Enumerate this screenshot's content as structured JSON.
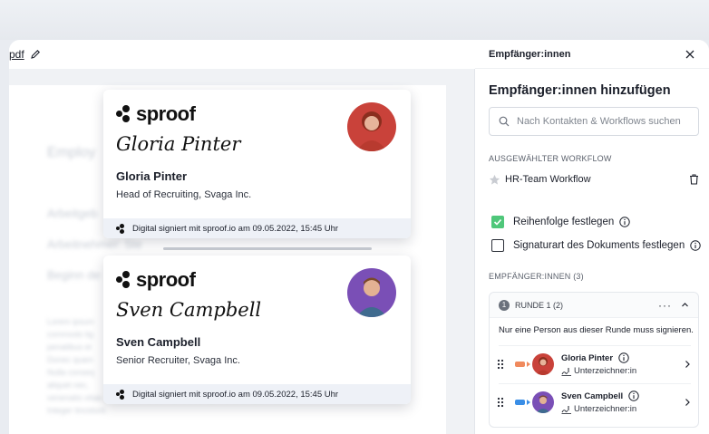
{
  "document": {
    "filename": "pdf",
    "blurred_heading": "Employ",
    "blurred_lines": [
      "Arbeitgeb",
      "Arbeitnehmer: Ste",
      "Beginn de"
    ],
    "blurred_paragraph": [
      "Lorem ipsum",
      "commodo lig",
      "penatibus et",
      "Donec quam",
      "Nulla conseq",
      "aliquet nec,",
      "venenatis vitae, justo. Nullam dictum felis eu pede mollis pretium.",
      "Integer tincidunt."
    ]
  },
  "cards": [
    {
      "logo": "sproof",
      "signature": "Gloria Pinter",
      "name": "Gloria Pinter",
      "role": "Head of Recruiting, Svaga Inc.",
      "footer": "Digital signiert mit sproof.io am 09.05.2022, 15:45 Uhr"
    },
    {
      "logo": "sproof",
      "signature": "Sven Campbell",
      "name": "Sven Campbell",
      "role": "Senior Recruiter, Svaga Inc.",
      "footer": "Digital signiert mit sproof.io am 09.05.2022, 15:45 Uhr"
    }
  ],
  "panel": {
    "header_title": "Empfänger:innen",
    "section_title": "Empfänger:innen hinzufügen",
    "search_placeholder": "Nach Kontakten & Workflows suchen",
    "selected_workflow_label": "AUSGEWÄHLTER WORKFLOW",
    "workflow_name": "HR-Team Workflow",
    "checkbox_order": {
      "label": "Reihenfolge festlegen",
      "checked": true
    },
    "checkbox_sigtype": {
      "label": "Signaturart des Dokuments festlegen",
      "checked": false
    },
    "recipients_label": "EMPFÄNGER:INNEN (3)",
    "round": {
      "number": "1",
      "label": "RUNDE 1 (2)",
      "more": "···",
      "note": "Nur eine Person aus dieser Runde muss signieren.",
      "signers": [
        {
          "name": "Gloria Pinter",
          "role": "Unterzeichner:in",
          "tag_color": "#f08a5d"
        },
        {
          "name": "Sven Campbell",
          "role": "Unterzeichner:in",
          "tag_color": "#3a8ee6"
        }
      ]
    }
  },
  "colors": {
    "accent_green": "#4fc77a",
    "text_dark": "#1b1f2a"
  }
}
